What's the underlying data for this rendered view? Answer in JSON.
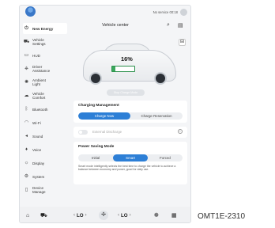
{
  "status_bar": {
    "text": "No service 00:18"
  },
  "sidebar": {
    "items": [
      {
        "label": "New Energy",
        "icon": "power-icon",
        "glyph": "⏻",
        "active": true
      },
      {
        "label": "Vehicle Settings",
        "icon": "car-icon",
        "glyph": "🚘",
        "active": false
      },
      {
        "label": "HUD",
        "icon": "hud-icon",
        "glyph": "▭",
        "active": false
      },
      {
        "label": "Driver Assistance",
        "icon": "steering-icon",
        "glyph": "⎈",
        "active": false
      },
      {
        "label": "Ambient Light",
        "icon": "light-icon",
        "glyph": "✺",
        "active": false
      },
      {
        "label": "Vehicle Comfort",
        "icon": "comfort-icon",
        "glyph": "☁",
        "active": false
      },
      {
        "label": "Bluetooth",
        "icon": "bluetooth-icon",
        "glyph": "ᛒ",
        "active": false
      },
      {
        "label": "Wi-Fi",
        "icon": "wifi-icon",
        "glyph": "◠",
        "active": false
      },
      {
        "label": "Sound",
        "icon": "sound-icon",
        "glyph": "◂)",
        "active": false
      },
      {
        "label": "Voice",
        "icon": "mic-icon",
        "glyph": "🎙",
        "active": false
      },
      {
        "label": "Display",
        "icon": "display-icon",
        "glyph": "☼",
        "active": false
      },
      {
        "label": "System",
        "icon": "gear-icon",
        "glyph": "⚙",
        "active": false
      },
      {
        "label": "Device Manage",
        "icon": "device-icon",
        "glyph": "▯",
        "active": false
      }
    ]
  },
  "main": {
    "title": "Vehicle center",
    "battery_percent": "16%",
    "battery_level": 0.16,
    "charge_button": "Stop Charge Mode",
    "charging": {
      "title": "Charging Management",
      "options": [
        "Charge Now",
        "Charge Reservation"
      ],
      "selected": 0
    },
    "external_discharge": {
      "label": "External Discharge",
      "enabled": false
    },
    "power_saving": {
      "title": "Power Saving Mode",
      "options": [
        "Initial",
        "Smart",
        "Forced"
      ],
      "selected": 1,
      "description": "Smart mode intelligently selects the best time to charge the vehicle to achieve a balance between economy and power, good for daily use."
    }
  },
  "bottom_bar": {
    "left_temp": "LO",
    "right_temp": "LO",
    "colors": {
      "accent": "#2d7fd6",
      "battery": "#3aa85c"
    }
  },
  "caption": "OMT1E-2310"
}
